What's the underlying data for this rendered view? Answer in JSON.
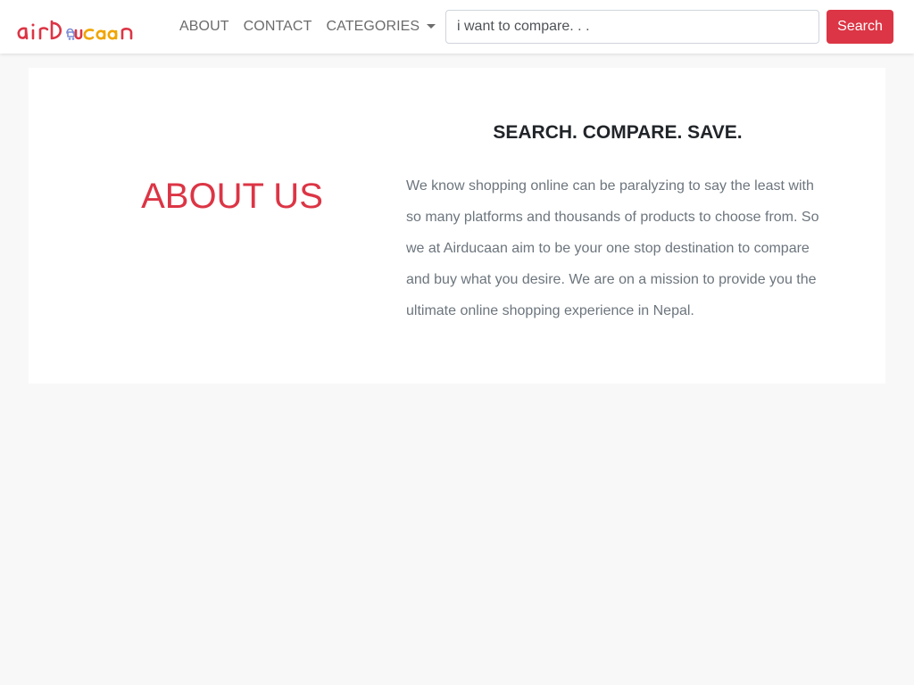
{
  "header": {
    "logo_text": "airDucaan",
    "logo_alt": "airDucaan logo",
    "nav": {
      "about": "ABOUT",
      "contact": "CONTACT",
      "categories": "CATEGORIES"
    },
    "search": {
      "placeholder": "i want to compare. . .",
      "button_label": "Search"
    }
  },
  "main": {
    "title": "ABOUT US",
    "tagline": "SEARCH. COMPARE. SAVE.",
    "description": "We know shopping online can be paralyzing to say the least with so many platforms and thousands of products to choose from. So we at Airducaan aim to be your one stop destination to compare and buy what you desire. We are on a mission to provide you the ultimate online shopping experience in Nepal."
  },
  "colors": {
    "accent": "#dc3545",
    "logo_secondary": "#f0a500",
    "logo_tertiary": "#7b8bd6",
    "page_background": "#f8f8f8",
    "card_background": "#ffffff",
    "nav_text": "#6c6c6c",
    "body_text": "#6c757d",
    "heading_text": "#212529"
  }
}
